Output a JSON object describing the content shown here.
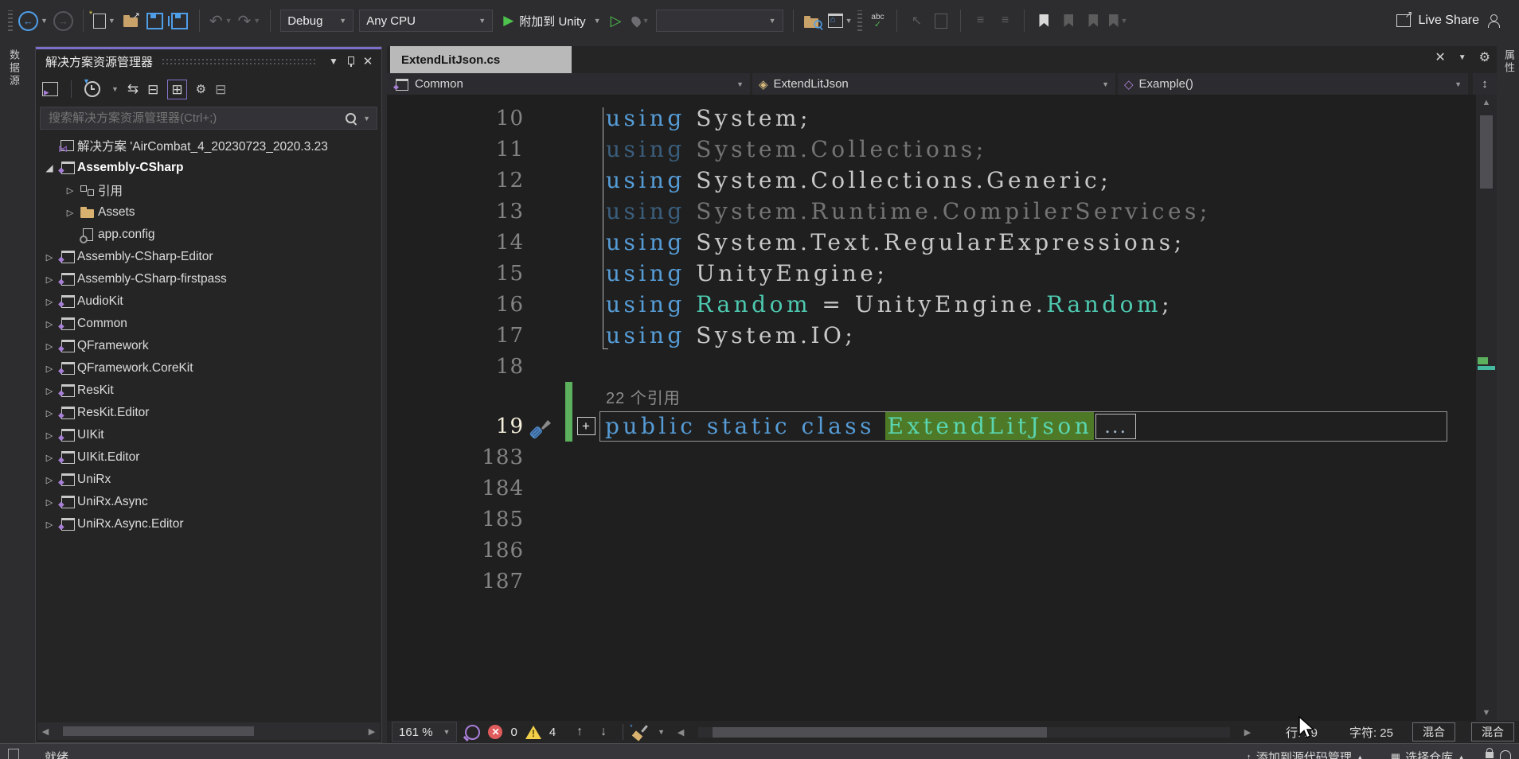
{
  "toolbar": {
    "debug": "Debug",
    "cpu": "Any CPU",
    "attach_unity": "附加到 Unity",
    "live_share": "Live Share"
  },
  "left_rail": {
    "label": "数据源"
  },
  "right_rail": {
    "label": "属性"
  },
  "solution_explorer": {
    "title": "解决方案资源管理器",
    "search_placeholder": "搜索解决方案资源管理器(Ctrl+;)",
    "items": [
      {
        "label": "解决方案 'AirCombat_4_20230723_2020.3.23",
        "icon": "solution",
        "expander": "none",
        "indent": 0,
        "weight": ""
      },
      {
        "label": "Assembly-CSharp",
        "icon": "project",
        "expander": "expanded",
        "indent": 0,
        "weight": "bold"
      },
      {
        "label": "引用",
        "icon": "refs",
        "expander": "collapsed",
        "indent": 1,
        "weight": ""
      },
      {
        "label": "Assets",
        "icon": "folder",
        "expander": "collapsed",
        "indent": 1,
        "weight": ""
      },
      {
        "label": "app.config",
        "icon": "config",
        "expander": "none",
        "indent": 1,
        "weight": ""
      },
      {
        "label": "Assembly-CSharp-Editor",
        "icon": "project",
        "expander": "collapsed",
        "indent": 0,
        "weight": ""
      },
      {
        "label": "Assembly-CSharp-firstpass",
        "icon": "project",
        "expander": "collapsed",
        "indent": 0,
        "weight": ""
      },
      {
        "label": "AudioKit",
        "icon": "project",
        "expander": "collapsed",
        "indent": 0,
        "weight": ""
      },
      {
        "label": "Common",
        "icon": "project",
        "expander": "collapsed",
        "indent": 0,
        "weight": ""
      },
      {
        "label": "QFramework",
        "icon": "project",
        "expander": "collapsed",
        "indent": 0,
        "weight": ""
      },
      {
        "label": "QFramework.CoreKit",
        "icon": "project",
        "expander": "collapsed",
        "indent": 0,
        "weight": ""
      },
      {
        "label": "ResKit",
        "icon": "project",
        "expander": "collapsed",
        "indent": 0,
        "weight": ""
      },
      {
        "label": "ResKit.Editor",
        "icon": "project",
        "expander": "collapsed",
        "indent": 0,
        "weight": ""
      },
      {
        "label": "UIKit",
        "icon": "project",
        "expander": "collapsed",
        "indent": 0,
        "weight": ""
      },
      {
        "label": "UIKit.Editor",
        "icon": "project",
        "expander": "collapsed",
        "indent": 0,
        "weight": ""
      },
      {
        "label": "UniRx",
        "icon": "project",
        "expander": "collapsed",
        "indent": 0,
        "weight": ""
      },
      {
        "label": "UniRx.Async",
        "icon": "project",
        "expander": "collapsed",
        "indent": 0,
        "weight": ""
      },
      {
        "label": "UniRx.Async.Editor",
        "icon": "project",
        "expander": "collapsed",
        "indent": 0,
        "weight": ""
      }
    ]
  },
  "editor": {
    "tab": "ExtendLitJson.cs",
    "nav": {
      "project": "Common",
      "type": "ExtendLitJson",
      "member": "Example()"
    },
    "lines": [
      {
        "num": "10",
        "tokens": [
          [
            "kw",
            "using "
          ],
          [
            "id",
            "System;"
          ]
        ]
      },
      {
        "num": "11",
        "dim": true,
        "tokens": [
          [
            "kw",
            "using "
          ],
          [
            "id",
            "System.Collections;"
          ]
        ]
      },
      {
        "num": "12",
        "tokens": [
          [
            "kw",
            "using "
          ],
          [
            "id",
            "System.Collections.Generic;"
          ]
        ]
      },
      {
        "num": "13",
        "dim": true,
        "tokens": [
          [
            "kw",
            "using "
          ],
          [
            "id",
            "System.Runtime.CompilerServices;"
          ]
        ]
      },
      {
        "num": "14",
        "tokens": [
          [
            "kw",
            "using "
          ],
          [
            "id",
            "System.Text.RegularExpressions;"
          ]
        ]
      },
      {
        "num": "15",
        "tokens": [
          [
            "kw",
            "using "
          ],
          [
            "id",
            "UnityEngine;"
          ]
        ]
      },
      {
        "num": "16",
        "tokens": [
          [
            "kw",
            "using "
          ],
          [
            "ty",
            "Random"
          ],
          [
            "id",
            " = "
          ],
          [
            "id",
            "UnityEngine."
          ],
          [
            "ty",
            "Random"
          ],
          [
            "id",
            ";"
          ]
        ]
      },
      {
        "num": "17",
        "tokens": [
          [
            "kw",
            "using "
          ],
          [
            "id",
            "System.IO;"
          ]
        ]
      },
      {
        "num": "18",
        "tokens": []
      }
    ],
    "codelens": "22 个引用",
    "line19": {
      "num": "19",
      "keywords": "public static class ",
      "name": "ExtendLitJson",
      "ellipsis": "..."
    },
    "trailing_lines": [
      "183",
      "184",
      "185",
      "186",
      "187"
    ]
  },
  "editor_statusbar": {
    "zoom": "161 %",
    "errors": "0",
    "warnings": "4",
    "line_label": "行: 19",
    "char_label": "字符: 25",
    "mixed1": "混合",
    "mixed2": "混合"
  },
  "statusbar": {
    "ready": "就绪",
    "add_source_control": "添加到源代码管理",
    "select_repo": "选择仓库"
  },
  "colors": {
    "accent_purple": "#7b6fc9",
    "keyword_blue": "#569cd6",
    "type_teal": "#4ec9b0",
    "selection_green": "#4e7a27",
    "change_bar_green": "#5caf5c",
    "editor_bg": "#1f1f1f",
    "chrome_bg": "#2d2d30"
  }
}
